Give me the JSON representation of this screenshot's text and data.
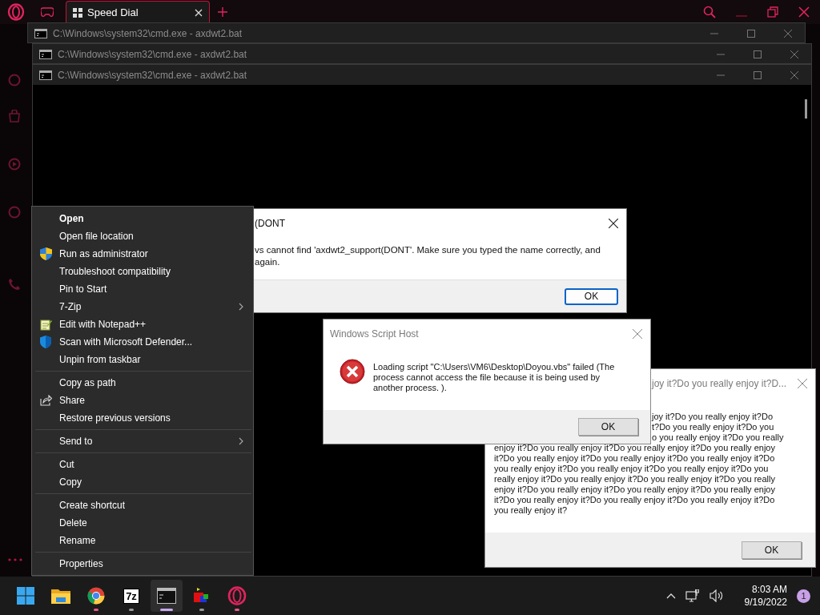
{
  "browser": {
    "tabs": [
      {
        "title": "Speed Dial",
        "selected": true
      }
    ]
  },
  "console_windows": [
    {
      "title": "C:\\Windows\\system32\\cmd.exe - axdwt2.bat"
    },
    {
      "title": "C:\\Windows\\system32\\cmd.exe - axdwt2.bat"
    },
    {
      "title": "C:\\Windows\\system32\\cmd.exe - axdwt2.bat"
    }
  ],
  "error_dialog": {
    "title": "(DONT",
    "message_lines": [
      "vs cannot find 'axdwt2_support(DONT'. Make sure you typed the name correctly, and",
      "again."
    ],
    "button": "OK",
    "button_focused": true
  },
  "script_host_dialog": {
    "title": "Windows Script Host",
    "message": "Loading script \"C:\\Users\\VM6\\Desktop\\Doyou.vbs\" failed (The process cannot access the file because it is being used by another process. ).",
    "button": "OK",
    "button_focused": false
  },
  "question_dialog": {
    "title": "joy it?Do you really enjoy it?D...",
    "covered_lines": [
      "joy it?Do you really enjoy it?Do",
      "t?Do you really enjoy it?Do you",
      "o you really enjoy it?Do you really"
    ],
    "lines": [
      "enjoy it?Do you really enjoy it?Do you really enjoy it?Do you really enjoy",
      "it?Do you really enjoy it?Do you really enjoy it?Do you really enjoy it?Do",
      "you really enjoy it?Do you really enjoy it?Do you really enjoy it?Do you",
      "really enjoy it?Do you really enjoy it?Do you really enjoy it?Do you really",
      "enjoy it?Do you really enjoy it?Do you really enjoy it?Do you really enjoy",
      "it?Do you really enjoy it?Do you really enjoy it?Do you really enjoy it?Do",
      "you really enjoy it?"
    ],
    "button": "OK",
    "button_focused": false
  },
  "context_menu": {
    "groups": [
      [
        {
          "label": "Open",
          "kind": "plain",
          "default": true
        },
        {
          "label": "Open file location",
          "kind": "plain",
          "default": false
        },
        {
          "label": "Run as administrator",
          "kind": "admin",
          "default": false
        },
        {
          "label": "Troubleshoot compatibility",
          "kind": "plain",
          "default": false
        },
        {
          "label": "Pin to Start",
          "kind": "plain",
          "default": false
        },
        {
          "label": "7-Zip",
          "kind": "submenu",
          "default": false
        },
        {
          "label": "Edit with Notepad++",
          "kind": "editor",
          "default": false
        },
        {
          "label": "Scan with Microsoft Defender...",
          "kind": "scan",
          "default": false
        },
        {
          "label": "Unpin from taskbar",
          "kind": "plain",
          "default": false
        }
      ],
      [
        {
          "label": "Copy as path",
          "kind": "plain",
          "default": false
        },
        {
          "label": "Share",
          "kind": "share",
          "default": false
        },
        {
          "label": "Restore previous versions",
          "kind": "plain",
          "default": false
        }
      ],
      [
        {
          "label": "Send to",
          "kind": "submenu",
          "default": false
        }
      ],
      [
        {
          "label": "Cut",
          "kind": "plain",
          "default": false
        },
        {
          "label": "Copy",
          "kind": "plain",
          "default": false
        }
      ],
      [
        {
          "label": "Create shortcut",
          "kind": "plain",
          "default": false
        },
        {
          "label": "Delete",
          "kind": "plain",
          "default": false
        },
        {
          "label": "Rename",
          "kind": "plain",
          "default": false
        }
      ],
      [
        {
          "label": "Properties",
          "kind": "plain",
          "default": false
        }
      ]
    ]
  },
  "taskbar": {
    "apps": [
      {
        "kind": "start",
        "running": false,
        "active": false
      },
      {
        "kind": "folder",
        "running": false,
        "active": false
      },
      {
        "kind": "browser",
        "running": true,
        "active": false
      },
      {
        "kind": "archive",
        "label": "7z",
        "running": true,
        "active": false
      },
      {
        "kind": "terminal",
        "running": true,
        "active": true
      },
      {
        "kind": "cubes",
        "running": true,
        "active": false
      },
      {
        "kind": "opera",
        "running": true,
        "active": false
      }
    ],
    "clock": {
      "time": "8:03 AM",
      "date": "9/19/2022"
    },
    "notification_count": "1"
  }
}
